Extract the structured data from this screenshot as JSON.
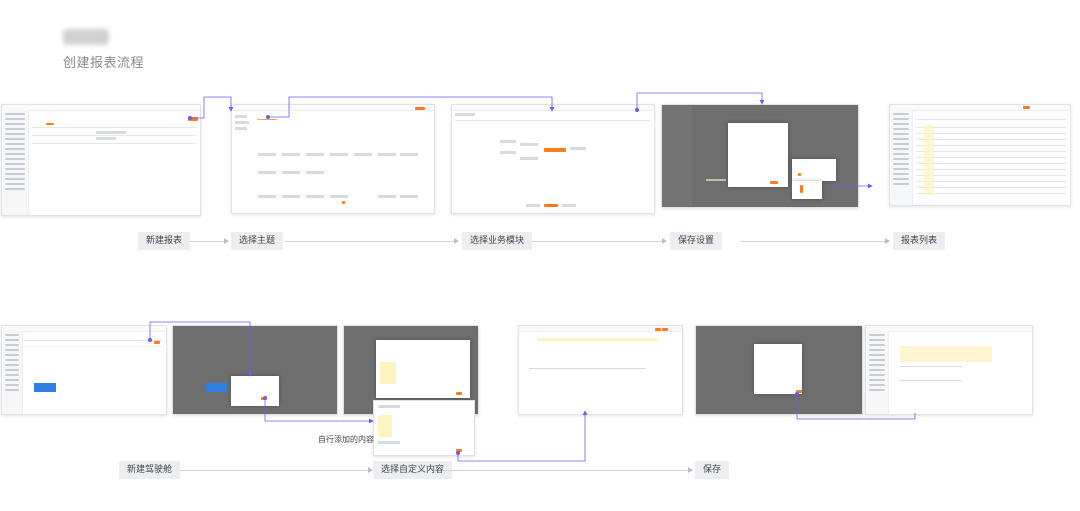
{
  "header": {
    "subtitle": "创建报表流程"
  },
  "flow1": {
    "steps": [
      "新建报表",
      "选择主题",
      "选择业务模块",
      "保存设置",
      "报表列表"
    ]
  },
  "flow2": {
    "steps": [
      "新建驾驶舱",
      "选择自定义内容",
      "保存"
    ],
    "note": "自行添加的内容"
  },
  "colors": {
    "accent": "#ff7a1a",
    "connector": "#6b5cf5",
    "step_bg": "#eceef1"
  }
}
